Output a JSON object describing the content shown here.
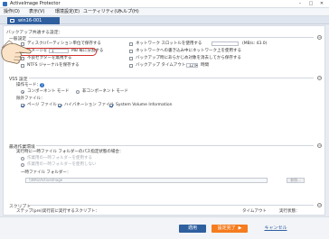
{
  "window": {
    "title": "ActiveImage Protector"
  },
  "menu": [
    {
      "label": "操作(O)"
    },
    {
      "label": "表示(V)"
    },
    {
      "label": "環境設定(E)"
    },
    {
      "label": "ユーティリティ(U)"
    },
    {
      "label": "ヘルプ(H)"
    }
  ],
  "tab": {
    "label": "win16-001"
  },
  "page": {
    "heading": "バックアップ共通する設定：",
    "general": {
      "title": "一般設定",
      "left": [
        {
          "label": "ディスク/パーティション単位で保存する",
          "checked": false
        },
        {
          "label": "イメージを",
          "checked": false,
          "value": "1",
          "suffix": "MB 毎に分割する"
        },
        {
          "label": "不良セクターを無視する",
          "checked": false
        },
        {
          "label": "NTFS ジャーナルを保存する",
          "checked": false
        }
      ],
      "right": [
        {
          "label": "ネットワーク スロットルを使用する",
          "checked": false,
          "hint": "(MB/s: 43.0)"
        },
        {
          "label": "ネットワークへの書き込み中にネットワーク上を使用する",
          "checked": false
        },
        {
          "label": "バックアップ時にあらかじめ対象を消去してから保存する",
          "checked": false
        },
        {
          "label": "バックアップ タイムアウト：",
          "checked": false,
          "value": "12",
          "suffix": "時間"
        }
      ]
    },
    "vss": {
      "title": "VSS 設定",
      "mode_label": "操作モード：",
      "help": "?",
      "modes": [
        {
          "label": "コンポーネント モード",
          "selected": true
        },
        {
          "label": "非コンポーネント モード",
          "selected": false
        }
      ],
      "exclude_label": "除外ファイル：",
      "excludes": [
        {
          "label": "ページ ファイル",
          "checked": true
        },
        {
          "label": "ハイバネーション ファイル",
          "checked": true
        },
        {
          "label": "System Volume Information",
          "checked": true
        }
      ]
    },
    "temp": {
      "title": "最適作業環境",
      "desc": "実行時に一時ファイル フォルダーのパス指定状態の場合：",
      "options": [
        {
          "label": "作業用の一時フォルダーを使用する"
        },
        {
          "label": "作業用の一時フォルダーを使用しない"
        }
      ],
      "folder_label": "一時ファイル フォルダー：",
      "folder_path": "\\\\NAS\\ActiveImage",
      "browse": "参照..."
    },
    "script": {
      "title": "スクリプト",
      "desc": "ステップ(pre)実行前に実行するスクリプト：",
      "col_timeout": "タイムアウト",
      "col_status": "実行状態："
    }
  },
  "footer": {
    "apply": "適用",
    "ok": "設定完了",
    "ok_arrow": "▶",
    "cancel": "キャンセル"
  },
  "colors": {
    "accent": "#2f5f9f",
    "ok_button": "#f57c1f",
    "highlight": "#d2322d"
  }
}
